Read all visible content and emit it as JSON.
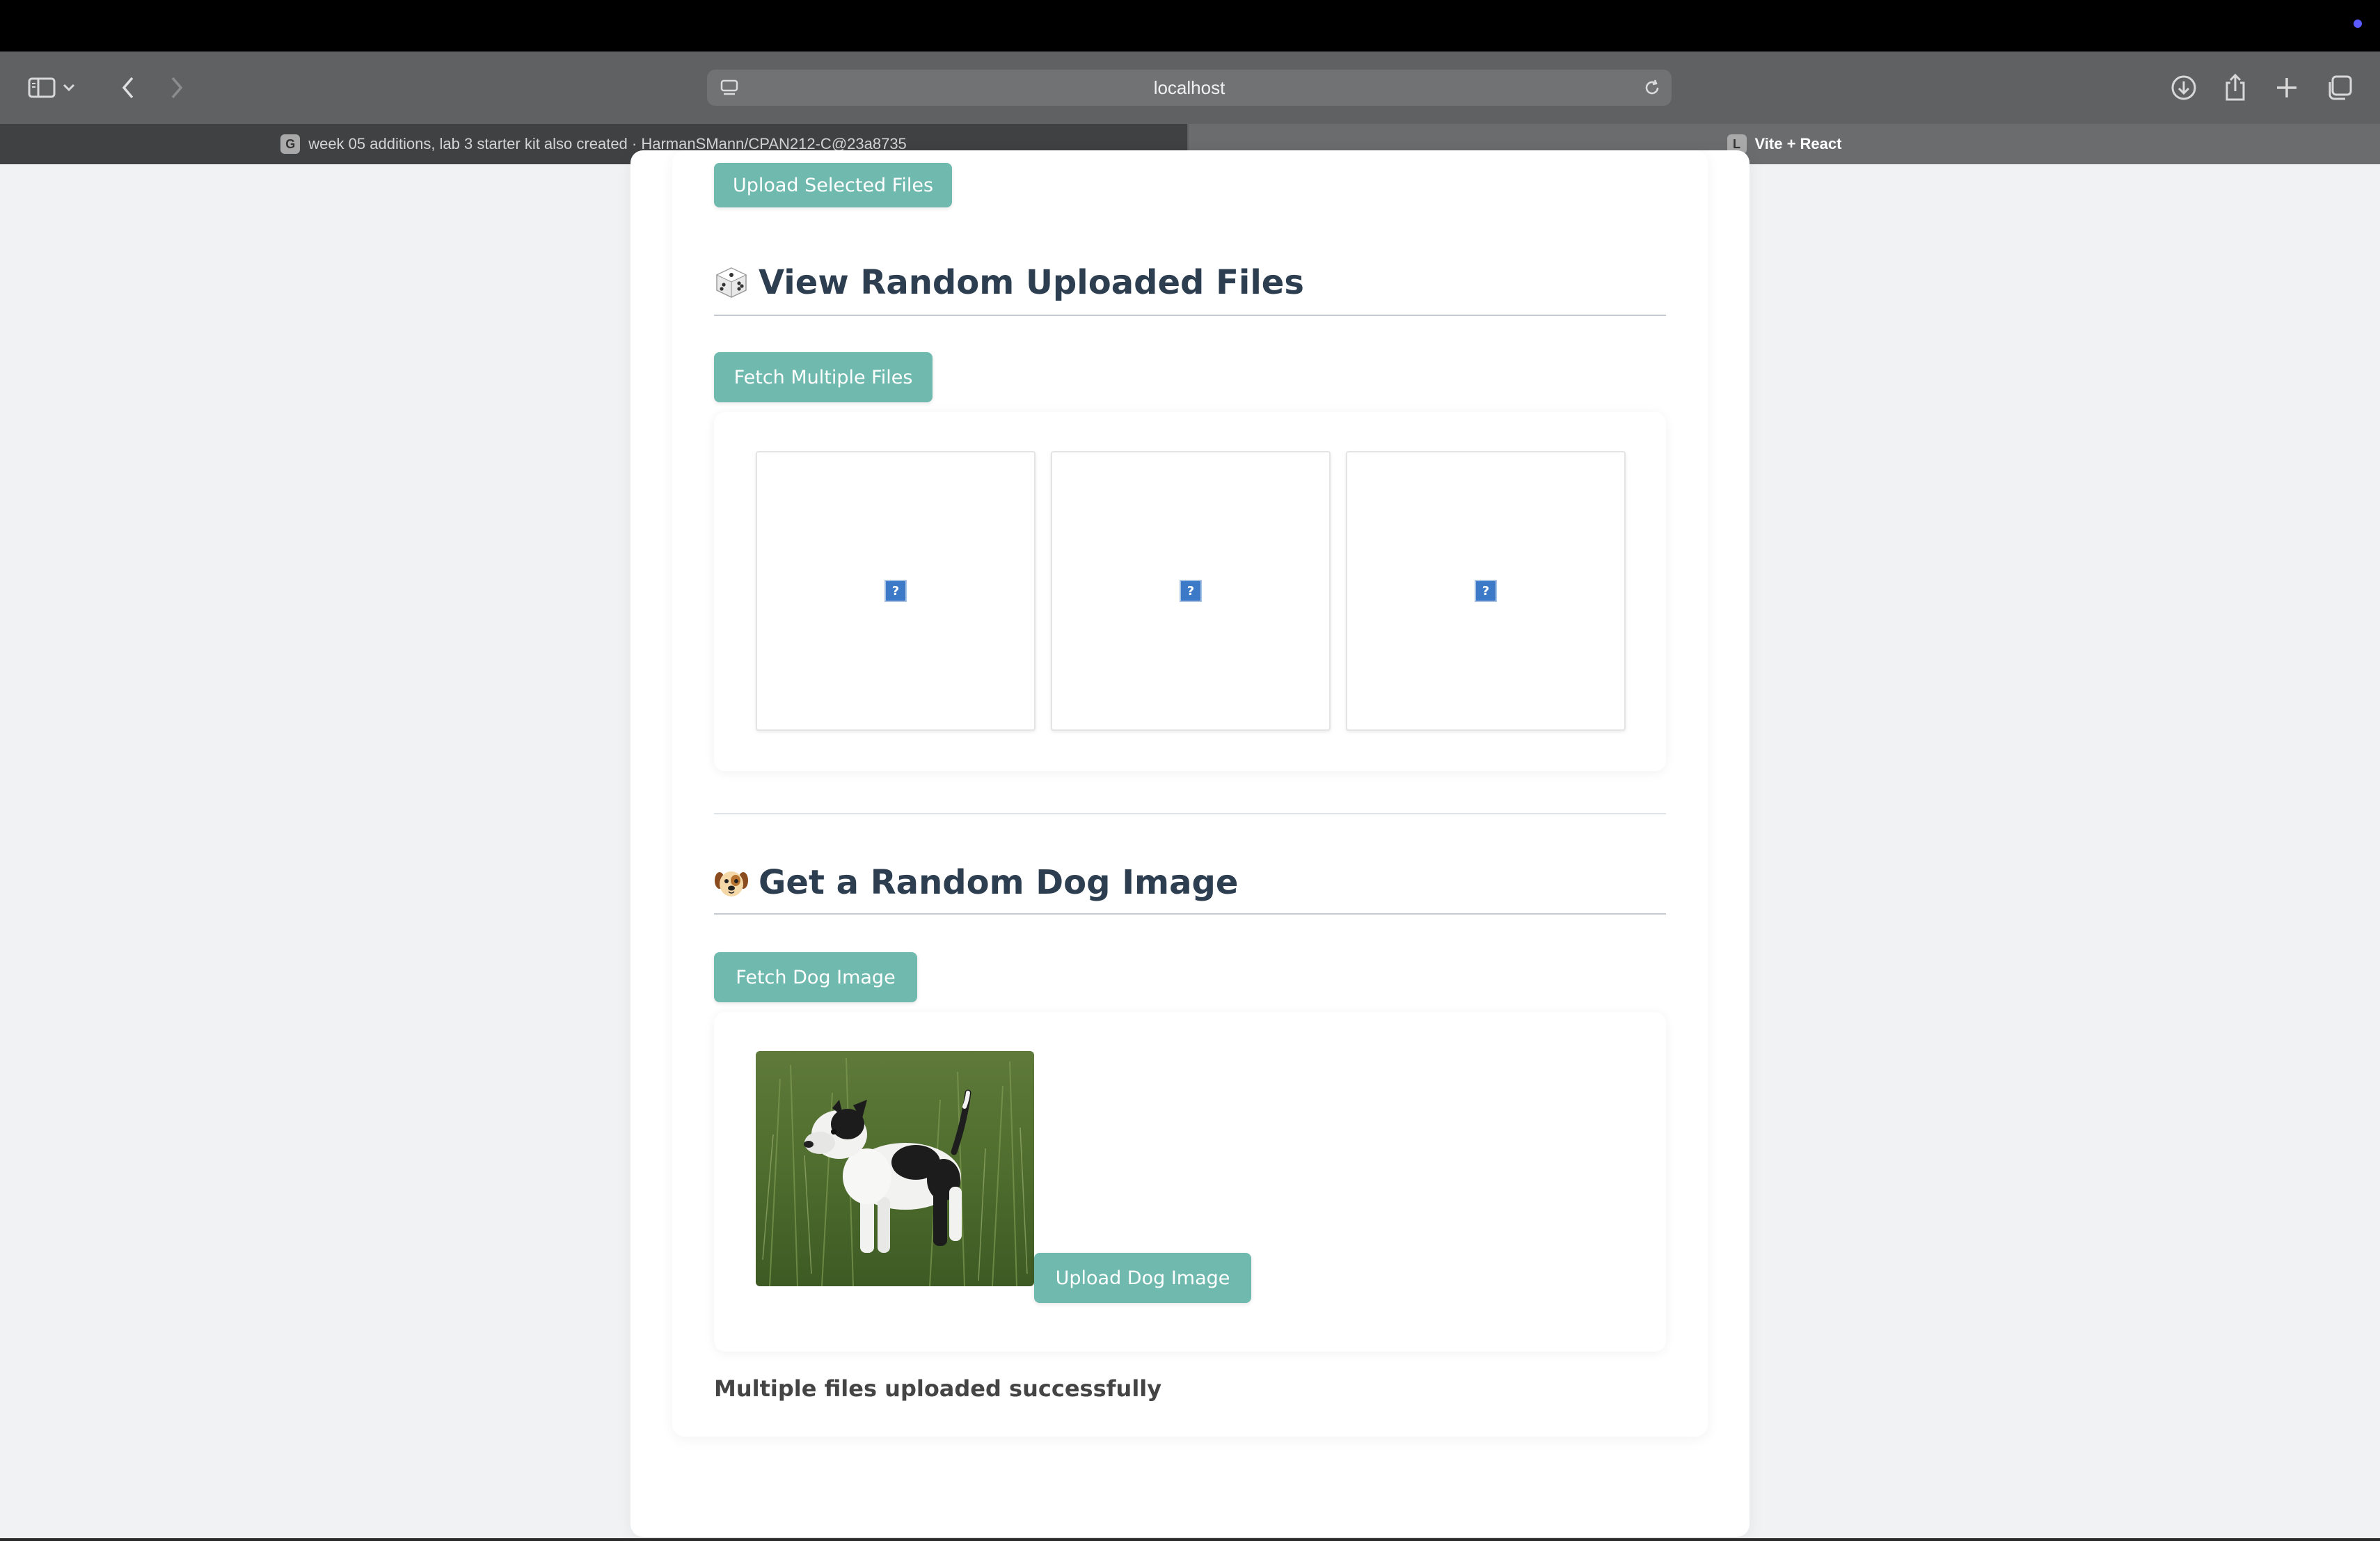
{
  "browser": {
    "url": "localhost",
    "tabs": [
      {
        "label": "week 05 additions, lab 3 starter kit also created · HarmanSMann/CPAN212-C@23a8735",
        "favicon": "G"
      },
      {
        "label": "Vite + React",
        "favicon": "L"
      }
    ]
  },
  "upload_section": {
    "button_label": "Upload Selected Files"
  },
  "random_files_section": {
    "heading": "View Random Uploaded Files",
    "emoji": "game-die-icon",
    "button_label": "Fetch Multiple Files",
    "broken_images": [
      "?",
      "?",
      "?"
    ]
  },
  "dog_section": {
    "heading": "Get a Random Dog Image",
    "emoji": "dog-face-icon",
    "button_label": "Fetch Dog Image",
    "upload_button_label": "Upload Dog Image"
  },
  "status_message": "Multiple files uploaded successfully",
  "colors": {
    "accent_button": "#6fb9ae",
    "heading_text": "#2c3e50",
    "page_background": "#f0f2f4"
  }
}
